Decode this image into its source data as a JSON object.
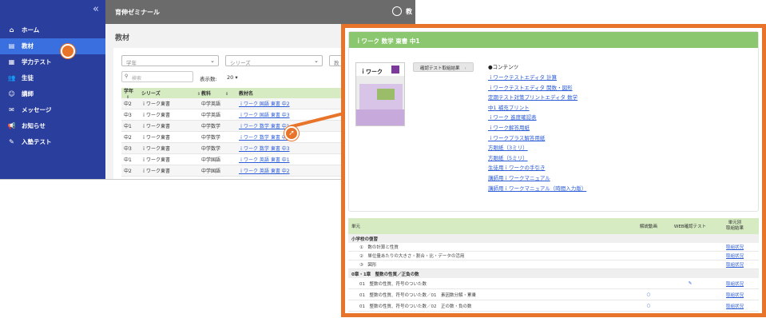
{
  "sidebar": {
    "collapse_icon": "«",
    "items": [
      {
        "label": "ホーム",
        "icon": "home-icon",
        "glyph": "⌂"
      },
      {
        "label": "教材",
        "icon": "book-icon",
        "glyph": "▤"
      },
      {
        "label": "学力テスト",
        "icon": "test-icon",
        "glyph": "▦"
      },
      {
        "label": "生徒",
        "icon": "users-icon",
        "glyph": "👥"
      },
      {
        "label": "講師",
        "icon": "teacher-icon",
        "glyph": "☺"
      },
      {
        "label": "メッセージ",
        "icon": "message-icon",
        "glyph": "✉"
      },
      {
        "label": "お知らせ",
        "icon": "megaphone-icon",
        "glyph": "📢"
      },
      {
        "label": "入塾テスト",
        "icon": "entry-test-icon",
        "glyph": "✎"
      }
    ]
  },
  "header": {
    "org": "育伸ゼミナール",
    "user": "教"
  },
  "page": {
    "title": "教材"
  },
  "filters": {
    "grade": "学年",
    "series": "シリーズ",
    "subject": "教"
  },
  "search": {
    "placeholder": "検索"
  },
  "count": {
    "label": "表示数:",
    "value": "20"
  },
  "table": {
    "headers": [
      "学年",
      "シリーズ",
      "教科",
      "教材名"
    ],
    "rows": [
      [
        "中2",
        "ｉワーク東書",
        "中学英語",
        "ｉワーク 国語 東書 中2"
      ],
      [
        "中3",
        "ｉワーク東書",
        "中学英語",
        "ｉワーク 国語 東書 中3"
      ],
      [
        "中1",
        "ｉワーク東書",
        "中学数学",
        "ｉワーク 数学 東書 中1"
      ],
      [
        "中2",
        "ｉワーク東書",
        "中学数学",
        "ｉワーク 数学 東書 中2"
      ],
      [
        "中3",
        "ｉワーク東書",
        "中学数学",
        "ｉワーク 数学 東書 中3"
      ],
      [
        "中1",
        "ｉワーク東書",
        "中学国語",
        "ｉワーク 英語 東書 中1"
      ],
      [
        "中2",
        "ｉワーク東書",
        "中学国語",
        "ｉワーク 英語 東書 中2"
      ]
    ]
  },
  "popup": {
    "title": "ｉワーク 数学 東書 中1",
    "cover_title": "ｉワーク",
    "tab_button": "確認テスト取組結果",
    "contents_heading": "●コンテンツ",
    "links": [
      "ｉワークテストエディタ 計算",
      "ｉワークテストエディタ 関数・図形",
      "定期テスト対策プリントエディタ 数学",
      "中1 補充プリント",
      "ｉワーク 進度確認表",
      "ｉワーク解答用紙",
      "ｉワークプラス解答用紙",
      "方眼紙（3ミリ）",
      "方眼紙（5ミリ）",
      "生徒用ｉワークの手引き",
      "講師用ｉワークマニュアル",
      "講師用ｉワークマニュアル（時間入力版）"
    ],
    "unit_table": {
      "headers": [
        "単元",
        "解説動画",
        "WEB確認テスト",
        "単元別\n取組結果"
      ],
      "sections": [
        {
          "title": "小学校の復習",
          "rows": [
            {
              "name": "①　数の計算と性質",
              "video": "",
              "web": "",
              "result": "取組状況"
            },
            {
              "name": "②　単位量あたりの大きさ・割合・比・データの活用",
              "video": "",
              "web": "",
              "result": "取組状況"
            },
            {
              "name": "③　図形",
              "video": "",
              "web": "",
              "result": "取組状況"
            }
          ]
        },
        {
          "title": "0章・1章　整数の性質／正負の数",
          "rows": [
            {
              "name": "01　整数の性質、符号のついた数",
              "video": "",
              "web": "✎",
              "result": "取組状況"
            },
            {
              "name": "01　整数の性質、符号のついた数／01　素因数分解・累乗",
              "video": "○",
              "web": "",
              "result": "取組状況"
            },
            {
              "name": "01　整数の性質、符号のついた数／02　正の数・負の数",
              "video": "○",
              "web": "",
              "result": "取組状況"
            }
          ]
        }
      ]
    }
  },
  "colors": {
    "sidebar": "#2a3e9e",
    "active": "#3a6fe0",
    "accent": "#e8742a",
    "header_green": "#8bc76e"
  }
}
